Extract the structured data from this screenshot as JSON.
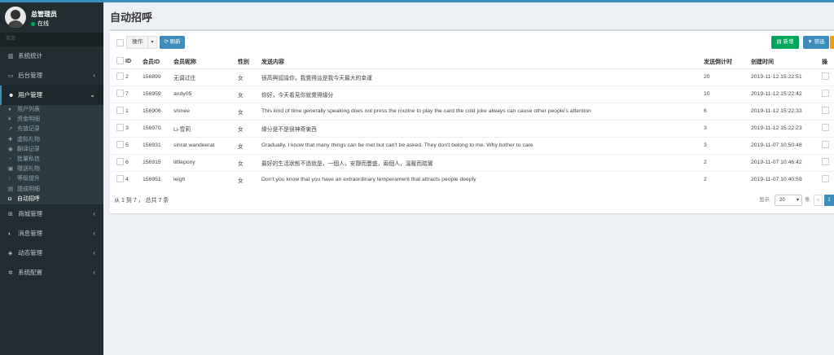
{
  "user": {
    "name": "总管理员",
    "status": "在线"
  },
  "sidebar": {
    "header": "菜单",
    "items": [
      {
        "label": "系统统计",
        "icon": "bar-chart-icon",
        "glyph": "▥"
      },
      {
        "label": "后台管理",
        "icon": "monitor-icon",
        "glyph": "▭",
        "caret": "‹"
      },
      {
        "label": "用户管理",
        "icon": "users-icon",
        "glyph": "☻",
        "caret": "⌄"
      }
    ],
    "sub_items": [
      {
        "label": "用户列表",
        "icon": "user-icon",
        "glyph": "●"
      },
      {
        "label": "资金明细",
        "icon": "yen-icon",
        "glyph": "¥"
      },
      {
        "label": "充值记录",
        "icon": "line-chart-icon",
        "glyph": "↗"
      },
      {
        "label": "虚拟礼物",
        "icon": "gift-icon",
        "glyph": "✚"
      },
      {
        "label": "翻译记录",
        "icon": "translate-icon",
        "glyph": "◉"
      },
      {
        "label": "批量私信",
        "icon": "chat-icon",
        "glyph": "◔"
      },
      {
        "label": "赠送礼物",
        "icon": "gift-send-icon",
        "glyph": "▣"
      },
      {
        "label": "等级提升",
        "icon": "arrow-up-icon",
        "glyph": "↑"
      },
      {
        "label": "提成明细",
        "icon": "file-icon",
        "glyph": "▤"
      },
      {
        "label": "自动招呼",
        "icon": "greeting-icon",
        "glyph": "◘"
      }
    ],
    "bottom_items": [
      {
        "label": "商城管理",
        "icon": "shop-icon",
        "glyph": "⊞",
        "caret": "‹"
      },
      {
        "label": "消息管理",
        "icon": "message-icon",
        "glyph": "◐",
        "caret": "‹"
      },
      {
        "label": "动态管理",
        "icon": "dynamic-icon",
        "glyph": "◈",
        "caret": "‹"
      },
      {
        "label": "系统配置",
        "icon": "cogs-icon",
        "glyph": "✲",
        "caret": "‹"
      }
    ]
  },
  "page": {
    "title": "自动招呼"
  },
  "toolbar": {
    "operate": "操作",
    "caret": "▾",
    "refresh": "⟳ 刷新",
    "add": "▤ 新增",
    "filter": "▼ 筛选"
  },
  "table": {
    "columns": [
      "ID",
      "会员ID",
      "会员昵称",
      "性别",
      "发送内容",
      "发送倒计时",
      "创建时间",
      "操"
    ],
    "rows": [
      {
        "id": "2",
        "member_id": "156899",
        "nickname": "无调过往",
        "gender": "女",
        "content": "很高興認識你，我覺得這是我今天最大的幸運",
        "countdown": "20",
        "created": "2019-11-12 15:22:51"
      },
      {
        "id": "7",
        "member_id": "156959",
        "nickname": "andy05",
        "gender": "女",
        "content": "你好，今天看見你就覺得緣分",
        "countdown": "10",
        "created": "2019-11-12 15:22:42"
      },
      {
        "id": "1",
        "member_id": "156906",
        "nickname": "shinee",
        "gender": "女",
        "content": "This kind of time generally speaking does not press the routine to play the card the cold joke always can cause other people's attention",
        "countdown": "6",
        "created": "2019-11-12 15:22:33"
      },
      {
        "id": "3",
        "member_id": "156970",
        "nickname": "Li-雪莉",
        "gender": "女",
        "content": "緣分是不是很神奇東西",
        "countdown": "3",
        "created": "2019-11-12 15:22:23"
      },
      {
        "id": "5",
        "member_id": "156931",
        "nickname": "sirirat wandeerat",
        "gender": "女",
        "content": "Gradually, I know that many things can be met but can't be asked. They don't belong to me. Why bother to care",
        "countdown": "3",
        "created": "2019-11-07 10:50:48"
      },
      {
        "id": "6",
        "member_id": "156915",
        "nickname": "littlepony",
        "gender": "女",
        "content": "最好的生活狀態不過就是，一個人，安靜而豐盛，兩個人，溫暖而踏實",
        "countdown": "2",
        "created": "2019-11-07 10:46:42"
      },
      {
        "id": "4",
        "member_id": "156951",
        "nickname": "leigh",
        "gender": "女",
        "content": "Don't you know that you have an extraordinary temperament that attracts people deeply",
        "countdown": "2",
        "created": "2019-11-07 10:40:59"
      }
    ]
  },
  "footer": {
    "summary": "从 1 到 7 ， 总共 7 条",
    "show_label": "显示",
    "page_size": "20",
    "unit": "条",
    "prev": "«",
    "current_page": "1"
  }
}
